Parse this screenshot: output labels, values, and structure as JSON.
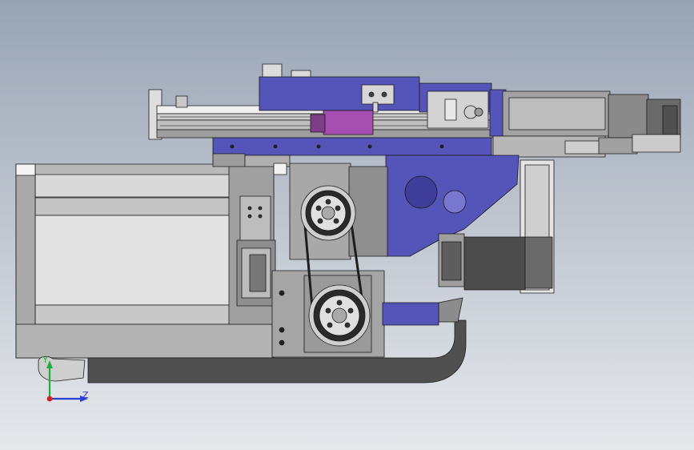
{
  "triad": {
    "y_label": "Y",
    "z_label": "Z",
    "x_color": "#d42020",
    "y_color": "#1fae3a",
    "z_color": "#2a3fd0"
  },
  "colors": {
    "accent_purple": "#5554b8",
    "magenta_block": "#a64fb0",
    "frame_light": "#cfcfcf",
    "frame_gray": "#a8a8a8",
    "dark_part": "#4a4a4a",
    "belt": "#1e1e1e"
  },
  "icons": {
    "triad": "coordinate-triad-icon"
  }
}
